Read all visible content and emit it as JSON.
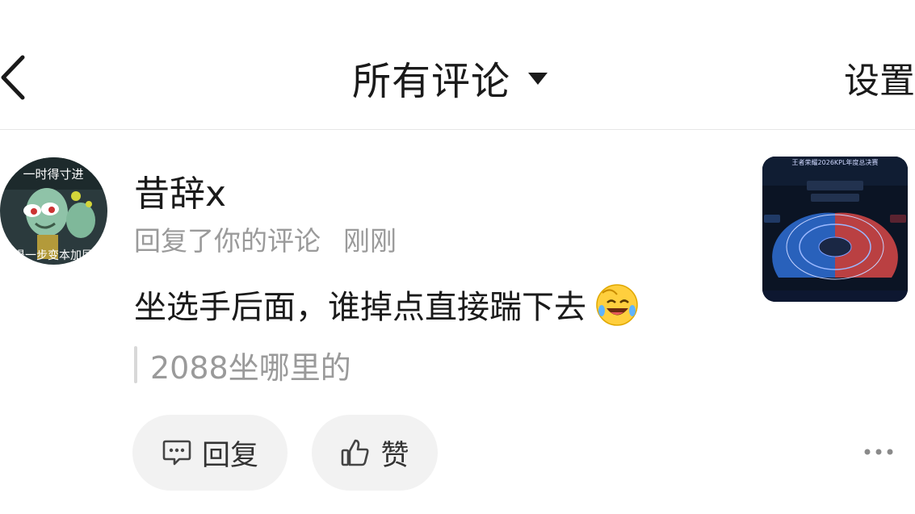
{
  "header": {
    "title": "所有评论",
    "settings_label": "设置"
  },
  "comment": {
    "username": "昔辞x",
    "action": "回复了你的评论",
    "time": "刚刚",
    "content": "坐选手后面，谁掉点直接踹下去",
    "quote": "2088坐哪里的",
    "reply_label": "回复",
    "like_label": "赞",
    "avatar_caption_top": "一时得寸进",
    "avatar_caption_bottom": "退一步变本加厉",
    "thumbnail_title": "王者荣耀2026KPL年度总决赛"
  },
  "icons": [
    "back-arrow-icon",
    "dropdown-caret-icon",
    "laughing-emoji-icon",
    "comment-bubble-icon",
    "thumbs-up-icon",
    "more-dots-icon"
  ],
  "colors": {
    "text": "#1a1a1a",
    "muted": "#9a9a9a",
    "pill_bg": "#f2f2f2",
    "divider": "#e6e6e6"
  }
}
